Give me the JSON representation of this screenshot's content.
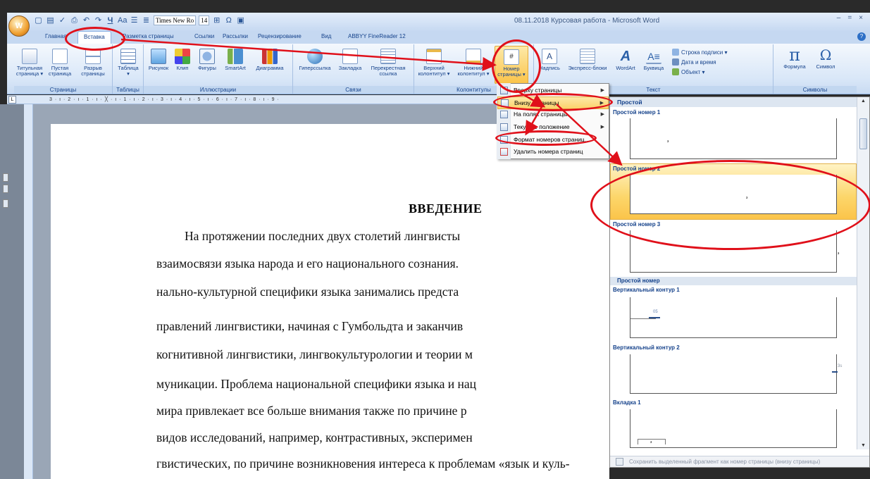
{
  "window": {
    "title": "08.11.2018 Курсовая работа - Microsoft Word",
    "font_name": "Times New Ro",
    "font_size": "14",
    "office_button": "W"
  },
  "tabs": [
    "Главная",
    "Вставка",
    "Разметка страницы",
    "Ссылки",
    "Рассылки",
    "Рецензирование",
    "Вид",
    "ABBYY FineReader 12"
  ],
  "ribbon": {
    "groups": {
      "pages": "Страницы",
      "tables": "Таблицы",
      "illustrations": "Иллюстрации",
      "links": "Связи",
      "headers": "Колонтитулы",
      "text": "Текст",
      "symbols": "Символы"
    },
    "buttons": {
      "cover_1": "Титульная",
      "cover_2": "страница ▾",
      "blank_1": "Пустая",
      "blank_2": "страница",
      "break_1": "Разрыв",
      "break_2": "страницы",
      "table": "Таблица",
      "table_2": "▾",
      "picture": "Рисунок",
      "clip": "Клип",
      "shapes": "Фигуры",
      "smartart": "SmartArt",
      "chart": "Диаграмма",
      "hyperlink": "Гиперссылка",
      "bookmark": "Закладка",
      "crossref_1": "Перекрестная",
      "crossref_2": "ссылка",
      "header_1": "Верхний",
      "header_2": "колонтитул ▾",
      "footer_1": "Нижний",
      "footer_2": "колонтитул ▾",
      "pagenum_1": "Номер",
      "pagenum_2": "страницы ▾",
      "textbox": "Надпись",
      "quickparts": "Экспресс-блоки",
      "wordart": "WordArt",
      "dropcap": "Буквица",
      "signature": "Строка подписи ▾",
      "datetime": "Дата и время",
      "object": "Объект ▾",
      "formula": "Формула",
      "symbol": "Символ"
    }
  },
  "ruler_text": "3 · ı · 2 · ı · 1 · ı · ╳ · ı · 1 · ı · 2 · ı · 3 · ı · 4 · ı · 5 · ı · 6 · ı · 7 · ı · 8 · ı · 9 ·",
  "menu": {
    "items": [
      {
        "label": "Вверху страницы"
      },
      {
        "label": "Внизу страницы"
      },
      {
        "label": "На полях страницы"
      },
      {
        "label": "Текущее положение"
      },
      {
        "label": "Формат номеров страниц..."
      },
      {
        "label": "Удалить номера страниц"
      }
    ]
  },
  "gallery": {
    "header": "Простой",
    "items": [
      {
        "label": "Простой номер 1",
        "num": "з"
      },
      {
        "label": "Простой номер 2",
        "num": "з"
      },
      {
        "label": "Простой номер 3",
        "num": "з"
      },
      {
        "label": "Вертикальный контур 1",
        "num": "05"
      },
      {
        "label": "Вертикальный контур 2",
        "num": "3s"
      },
      {
        "label": "Вкладка 1",
        "num": "з"
      }
    ],
    "separator": "Простой номер",
    "footer": "Сохранить выделенный фрагмент как номер страницы (внизу страницы)"
  },
  "document": {
    "heading": "ВВЕДЕНИЕ",
    "lines": [
      "На протяжении последних двух столетий лингвисты",
      "взаимосвязи языка народа и его национального сознания.",
      "нально-культурной специфики языка занимались предста",
      "правлений лингвистики, начиная с Гумбольдта и заканчив",
      "когнитивной лингвистики, лингвокультурологии и теории м",
      "муникации. Проблема национальной специфики языка и нац",
      "мира привлекает все больше внимания также по причине р",
      "видов исследований, например, контрастивных, эксперимен",
      "гвистических, по причине возникновения интереса к проблемам «язык и куль-"
    ]
  },
  "colors": {
    "annotation": "#e0101a",
    "highlight": "#fbd36b",
    "ribbon_text": "#15428b"
  }
}
